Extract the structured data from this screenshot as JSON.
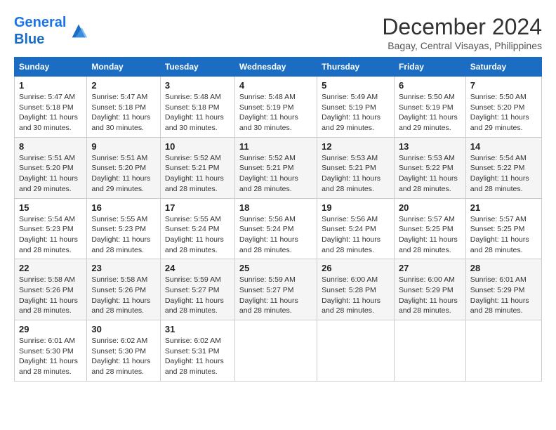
{
  "header": {
    "logo_line1": "General",
    "logo_line2": "Blue",
    "month_title": "December 2024",
    "location": "Bagay, Central Visayas, Philippines"
  },
  "weekdays": [
    "Sunday",
    "Monday",
    "Tuesday",
    "Wednesday",
    "Thursday",
    "Friday",
    "Saturday"
  ],
  "weeks": [
    [
      {
        "day": "1",
        "sunrise": "5:47 AM",
        "sunset": "5:18 PM",
        "daylight": "11 hours and 30 minutes."
      },
      {
        "day": "2",
        "sunrise": "5:47 AM",
        "sunset": "5:18 PM",
        "daylight": "11 hours and 30 minutes."
      },
      {
        "day": "3",
        "sunrise": "5:48 AM",
        "sunset": "5:18 PM",
        "daylight": "11 hours and 30 minutes."
      },
      {
        "day": "4",
        "sunrise": "5:48 AM",
        "sunset": "5:19 PM",
        "daylight": "11 hours and 30 minutes."
      },
      {
        "day": "5",
        "sunrise": "5:49 AM",
        "sunset": "5:19 PM",
        "daylight": "11 hours and 29 minutes."
      },
      {
        "day": "6",
        "sunrise": "5:50 AM",
        "sunset": "5:19 PM",
        "daylight": "11 hours and 29 minutes."
      },
      {
        "day": "7",
        "sunrise": "5:50 AM",
        "sunset": "5:20 PM",
        "daylight": "11 hours and 29 minutes."
      }
    ],
    [
      {
        "day": "8",
        "sunrise": "5:51 AM",
        "sunset": "5:20 PM",
        "daylight": "11 hours and 29 minutes."
      },
      {
        "day": "9",
        "sunrise": "5:51 AM",
        "sunset": "5:20 PM",
        "daylight": "11 hours and 29 minutes."
      },
      {
        "day": "10",
        "sunrise": "5:52 AM",
        "sunset": "5:21 PM",
        "daylight": "11 hours and 28 minutes."
      },
      {
        "day": "11",
        "sunrise": "5:52 AM",
        "sunset": "5:21 PM",
        "daylight": "11 hours and 28 minutes."
      },
      {
        "day": "12",
        "sunrise": "5:53 AM",
        "sunset": "5:21 PM",
        "daylight": "11 hours and 28 minutes."
      },
      {
        "day": "13",
        "sunrise": "5:53 AM",
        "sunset": "5:22 PM",
        "daylight": "11 hours and 28 minutes."
      },
      {
        "day": "14",
        "sunrise": "5:54 AM",
        "sunset": "5:22 PM",
        "daylight": "11 hours and 28 minutes."
      }
    ],
    [
      {
        "day": "15",
        "sunrise": "5:54 AM",
        "sunset": "5:23 PM",
        "daylight": "11 hours and 28 minutes."
      },
      {
        "day": "16",
        "sunrise": "5:55 AM",
        "sunset": "5:23 PM",
        "daylight": "11 hours and 28 minutes."
      },
      {
        "day": "17",
        "sunrise": "5:55 AM",
        "sunset": "5:24 PM",
        "daylight": "11 hours and 28 minutes."
      },
      {
        "day": "18",
        "sunrise": "5:56 AM",
        "sunset": "5:24 PM",
        "daylight": "11 hours and 28 minutes."
      },
      {
        "day": "19",
        "sunrise": "5:56 AM",
        "sunset": "5:24 PM",
        "daylight": "11 hours and 28 minutes."
      },
      {
        "day": "20",
        "sunrise": "5:57 AM",
        "sunset": "5:25 PM",
        "daylight": "11 hours and 28 minutes."
      },
      {
        "day": "21",
        "sunrise": "5:57 AM",
        "sunset": "5:25 PM",
        "daylight": "11 hours and 28 minutes."
      }
    ],
    [
      {
        "day": "22",
        "sunrise": "5:58 AM",
        "sunset": "5:26 PM",
        "daylight": "11 hours and 28 minutes."
      },
      {
        "day": "23",
        "sunrise": "5:58 AM",
        "sunset": "5:26 PM",
        "daylight": "11 hours and 28 minutes."
      },
      {
        "day": "24",
        "sunrise": "5:59 AM",
        "sunset": "5:27 PM",
        "daylight": "11 hours and 28 minutes."
      },
      {
        "day": "25",
        "sunrise": "5:59 AM",
        "sunset": "5:27 PM",
        "daylight": "11 hours and 28 minutes."
      },
      {
        "day": "26",
        "sunrise": "6:00 AM",
        "sunset": "5:28 PM",
        "daylight": "11 hours and 28 minutes."
      },
      {
        "day": "27",
        "sunrise": "6:00 AM",
        "sunset": "5:29 PM",
        "daylight": "11 hours and 28 minutes."
      },
      {
        "day": "28",
        "sunrise": "6:01 AM",
        "sunset": "5:29 PM",
        "daylight": "11 hours and 28 minutes."
      }
    ],
    [
      {
        "day": "29",
        "sunrise": "6:01 AM",
        "sunset": "5:30 PM",
        "daylight": "11 hours and 28 minutes."
      },
      {
        "day": "30",
        "sunrise": "6:02 AM",
        "sunset": "5:30 PM",
        "daylight": "11 hours and 28 minutes."
      },
      {
        "day": "31",
        "sunrise": "6:02 AM",
        "sunset": "5:31 PM",
        "daylight": "11 hours and 28 minutes."
      },
      null,
      null,
      null,
      null
    ]
  ]
}
